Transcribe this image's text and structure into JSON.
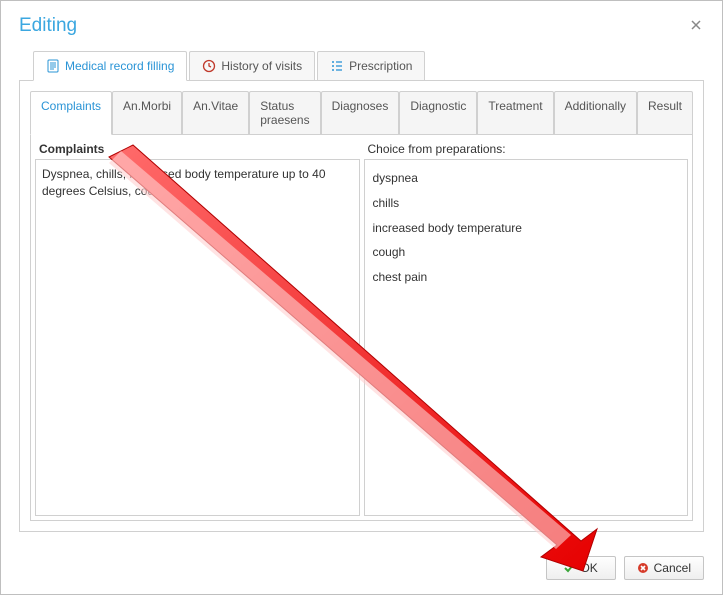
{
  "window": {
    "title": "Editing"
  },
  "main_tabs": {
    "t0": {
      "label": "Medical record filling"
    },
    "t1": {
      "label": "History of visits"
    },
    "t2": {
      "label": "Prescription"
    }
  },
  "sub_tabs": {
    "s0": {
      "label": "Complaints"
    },
    "s1": {
      "label": "An.Morbi"
    },
    "s2": {
      "label": "An.Vitae"
    },
    "s3": {
      "label": "Status praesens"
    },
    "s4": {
      "label": "Diagnoses"
    },
    "s5": {
      "label": "Diagnostic"
    },
    "s6": {
      "label": "Treatment"
    },
    "s7": {
      "label": "Additionally"
    },
    "s8": {
      "label": "Result"
    }
  },
  "complaints": {
    "header": "Complaints",
    "text": "Dyspnea, chills, increased body temperature up to 40 degrees Celsius, cough"
  },
  "preparations": {
    "header": "Choice from preparations:",
    "items": {
      "i0": "dyspnea",
      "i1": "chills",
      "i2": "increased body temperature",
      "i3": "cough",
      "i4": "chest pain"
    }
  },
  "buttons": {
    "ok": "OK",
    "cancel": "Cancel"
  }
}
